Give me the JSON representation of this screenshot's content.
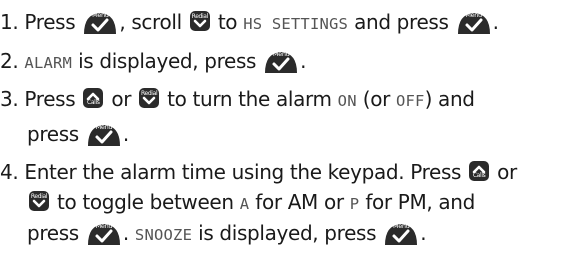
{
  "steps": [
    {
      "number": "1.",
      "text_press": "Press",
      "text_scroll": ", scroll",
      "text_to": "to",
      "display_hs_settings": "HS SETTINGS",
      "text_and_press": "and press",
      "text_end": "."
    },
    {
      "number": "2.",
      "display_alarm": "ALARM",
      "text_is_displayed_press": "is displayed, press",
      "text_end": "."
    },
    {
      "number": "3.",
      "text_press": "Press",
      "text_or": "or",
      "text_turn": "to turn the alarm",
      "display_on": "ON",
      "text_or_paren": "(or",
      "display_off": "OFF",
      "text_and": ") and",
      "text_press2": "press",
      "text_end": "."
    },
    {
      "number": "4.",
      "text_line1": "Enter the alarm time using the keypad. Press",
      "text_or1": "or",
      "text_toggle": "to toggle between",
      "display_a": "A",
      "text_for_am": "for AM or",
      "display_p": "P",
      "text_for_pm": "for PM, and",
      "text_press": "press",
      "text_dot": ".",
      "display_snooze": "SNOOZE",
      "text_is_displayed_press": "is displayed, press",
      "text_end": "."
    }
  ],
  "keys": {
    "menu_label": "Menu",
    "redial_label": "Redial",
    "calls_label": "Calls"
  },
  "colors": {
    "key_fill": "#2b2b2b",
    "display_text": "#555555"
  }
}
